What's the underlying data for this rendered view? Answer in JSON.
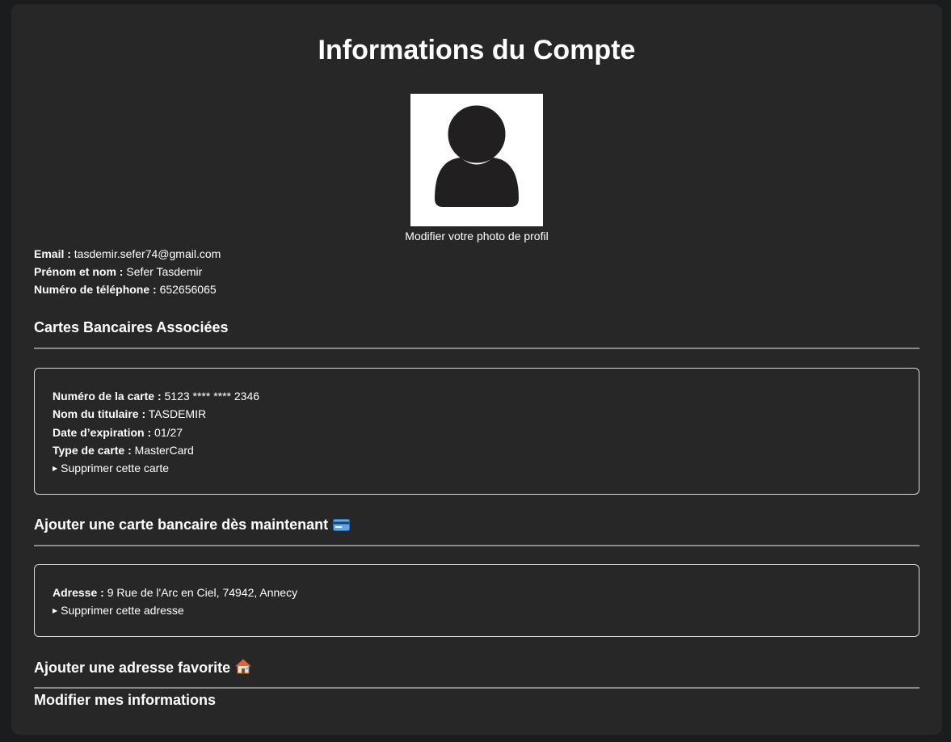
{
  "page": {
    "title": "Informations du Compte",
    "avatar_caption": "Modifier votre photo de profil"
  },
  "user": {
    "email_label": "Email :",
    "email": "tasdemir.sefer74@gmail.com",
    "name_label": "Prénom et nom :",
    "name": "Sefer Tasdemir",
    "phone_label": "Numéro de téléphone :",
    "phone": "652656065"
  },
  "cards_section": {
    "title": "Cartes Bancaires Associées",
    "card": {
      "number_label": "Numéro de la carte :",
      "number": "5123 **** **** 2346",
      "holder_label": "Nom du titulaire :",
      "holder": "TASDEMIR",
      "expiry_label": "Date d’expiration :",
      "expiry": "01/27",
      "type_label": "Type de carte :",
      "type": "MasterCard",
      "delete_label": "Supprimer cette carte"
    }
  },
  "add_card": {
    "title": "Ajouter une carte bancaire dès maintenant",
    "icon": "credit-card-icon"
  },
  "address_section": {
    "address_label": "Adresse :",
    "address": "9 Rue de l'Arc en Ciel, 74942, Annecy",
    "delete_label": "Supprimer cette adresse"
  },
  "add_address": {
    "title": "Ajouter une adresse favorite",
    "icon": "house-icon"
  },
  "edit_info": {
    "title": "Modifier mes informations"
  },
  "colors": {
    "page_bg": "#1b1c1d",
    "panel_bg": "#272727",
    "text": "#ffffff",
    "divider": "#8a8a8a",
    "box_border": "#d8d8d8"
  }
}
